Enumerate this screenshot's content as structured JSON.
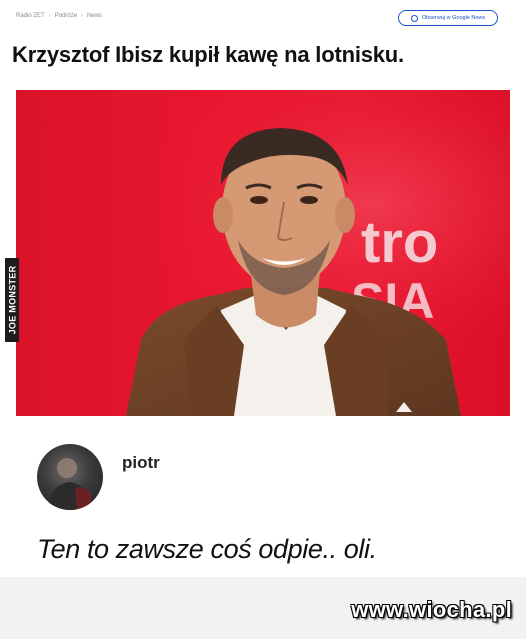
{
  "breadcrumb": {
    "items": [
      "Radio ZET",
      "Podróże",
      "News"
    ],
    "separator": "›"
  },
  "follow_button": {
    "label": "Obserwuj w Google News",
    "icon": "google-news-icon",
    "color": "#1a56c9"
  },
  "article": {
    "title": "Krzysztof Ibisz kupił kawę na lotnisku.",
    "photo": {
      "background_color": "#e8172f",
      "backdrop_text_top": "tro",
      "backdrop_text_bottom": "SIA",
      "watermark": "JOE MONSTER"
    }
  },
  "comment": {
    "username": "piotr",
    "avatar_icon": "user-avatar",
    "text": "Ten to zawsze coś odpie.. oli."
  },
  "site_watermark": "www.wiocha.pl"
}
